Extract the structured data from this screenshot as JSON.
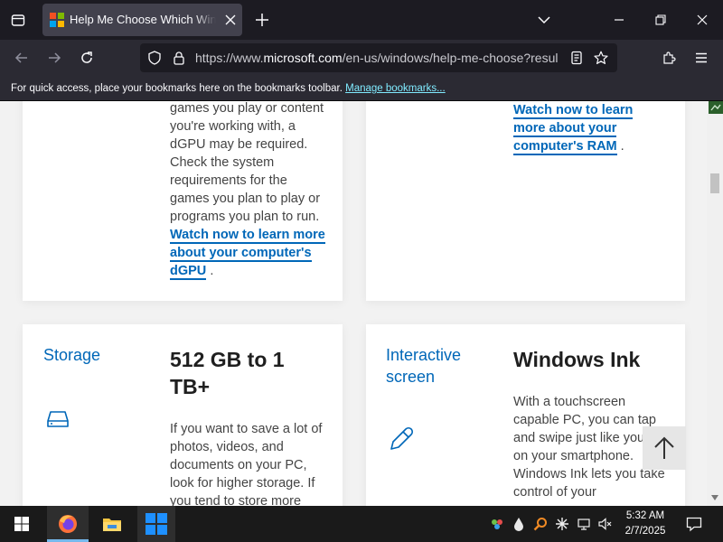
{
  "browser": {
    "tab": {
      "title": "Help Me Choose Which Windows"
    },
    "url": {
      "prefix": "https://www.",
      "domain": "microsoft.com",
      "path": "/en-us/windows/help-me-choose?resul"
    },
    "bookmarks_bar": {
      "message": "For quick access, place your bookmarks here on the bookmarks toolbar.",
      "link": "Manage bookmarks..."
    }
  },
  "page": {
    "card_dgpu": {
      "text": "games you play or content you're working with, a dGPU may be required. Check the system requirements for the games you plan to play or programs you plan to run.",
      "link": "Watch now to learn more about your computer's dGPU",
      "after": "."
    },
    "card_ram": {
      "link": "Watch now to learn more about your computer's RAM",
      "after": "."
    },
    "card_storage": {
      "category": "Storage",
      "icon": "hard-drive-icon",
      "spec": "512 GB to 1 TB+",
      "text": "If you want to save a lot of photos, videos, and documents on your PC, look for higher storage. If you tend to store more"
    },
    "card_screen": {
      "category": "Interactive screen",
      "icon": "pen-icon",
      "spec": "Windows Ink",
      "text": "With a touchscreen capable PC, you can tap and swipe just like you do on your smartphone. Windows Ink lets you take control of your"
    },
    "back_to_top": {
      "icon": "arrow-up-icon"
    }
  },
  "taskbar": {
    "clock": {
      "time": "5:32 AM",
      "date": "2/7/2025"
    }
  },
  "colors": {
    "accent": "#0067b8",
    "chrome_dark": "#1c1b22",
    "chrome": "#2b2a33",
    "link_chrome": "#80ebff"
  }
}
